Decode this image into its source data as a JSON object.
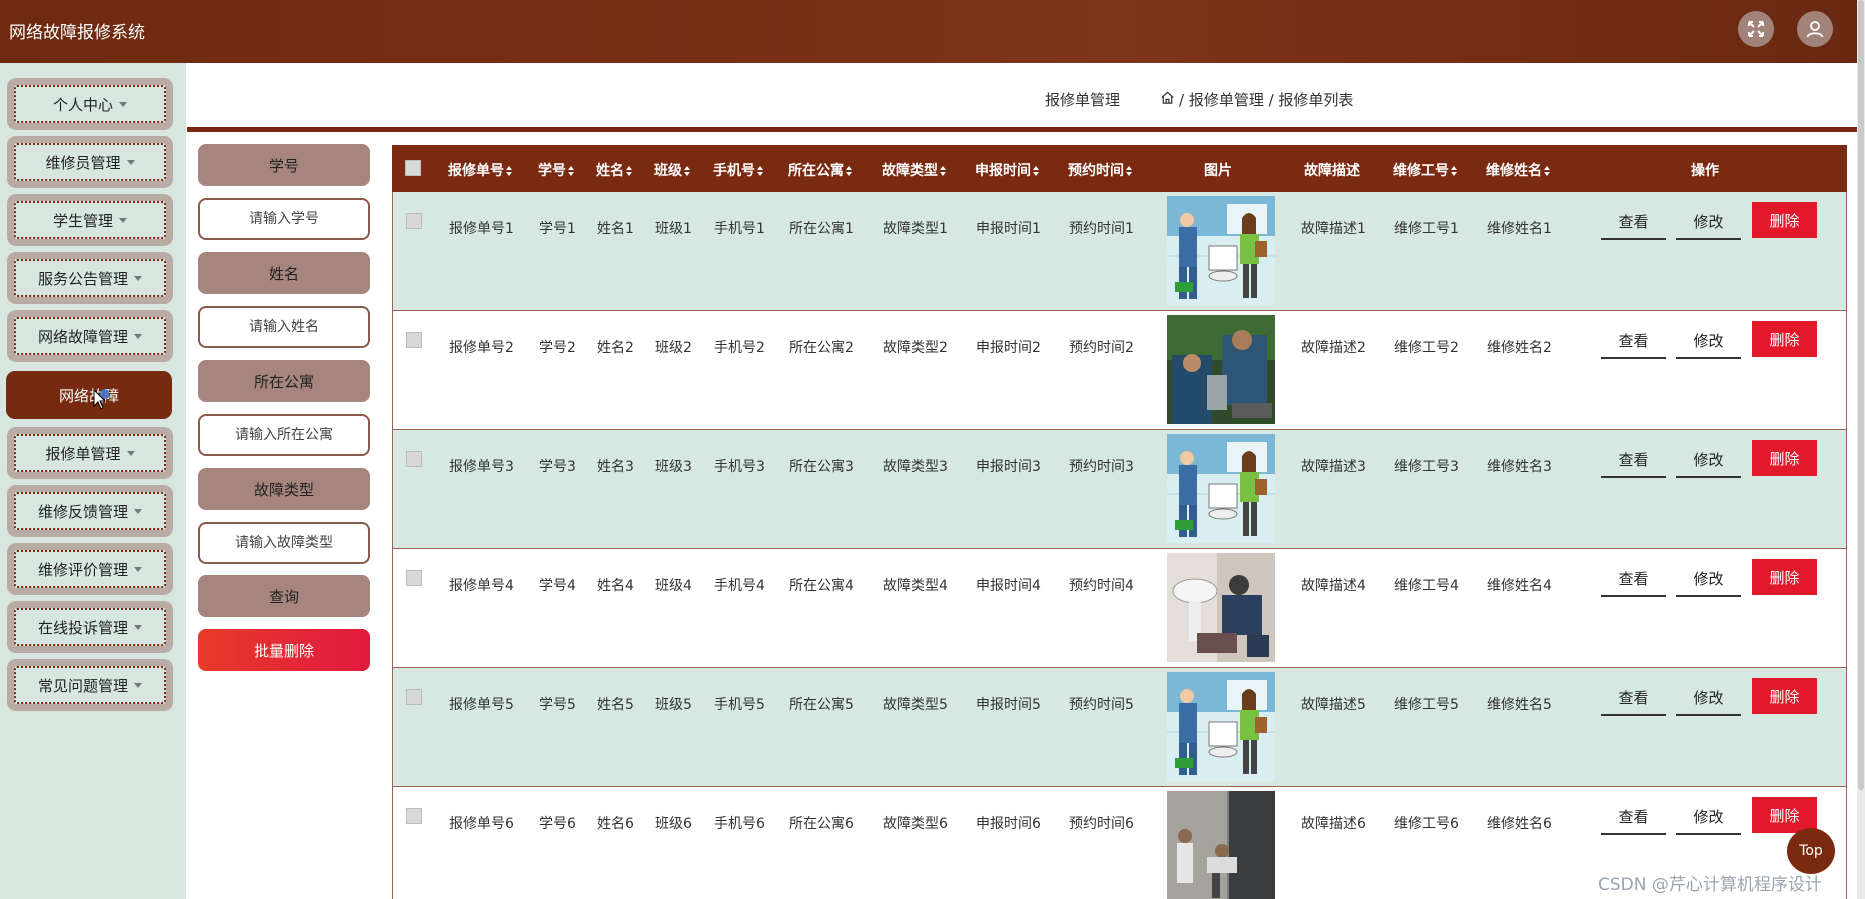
{
  "header": {
    "title": "网络故障报修系统",
    "brand_color": "#7b2a12"
  },
  "sidebar": {
    "items": [
      {
        "label": "个人中心"
      },
      {
        "label": "维修员管理"
      },
      {
        "label": "学生管理"
      },
      {
        "label": "服务公告管理"
      },
      {
        "label": "网络故障管理"
      },
      {
        "label": "网络故障",
        "active": true
      },
      {
        "label": "报修单管理"
      },
      {
        "label": "维修反馈管理"
      },
      {
        "label": "维修评价管理"
      },
      {
        "label": "在线投诉管理"
      },
      {
        "label": "常见问题管理"
      }
    ]
  },
  "breadcrumb": {
    "module": "报修单管理",
    "trail": "/ 报修单管理 / 报修单列表"
  },
  "search": {
    "label_id": "学号",
    "placeholder_id": "请输入学号",
    "label_name": "姓名",
    "placeholder_name": "请输入姓名",
    "label_apartment": "所在公寓",
    "placeholder_apartment": "请输入所在公寓",
    "label_fault": "故障类型",
    "placeholder_fault": "请输入故障类型",
    "query_label": "查询",
    "batch_delete_label": "批量删除"
  },
  "table": {
    "columns": [
      "报修单号",
      "学号",
      "姓名",
      "班级",
      "手机号",
      "所在公寓",
      "故障类型",
      "申报时间",
      "预约时间",
      "图片",
      "故障描述",
      "维修工号",
      "维修姓名",
      "操作"
    ],
    "rows": [
      {
        "no": "报修单号1",
        "sid": "学号1",
        "name": "姓名1",
        "cls": "班级1",
        "phone": "手机号1",
        "apt": "所在公寓1",
        "fault": "故障类型1",
        "report": "申报时间1",
        "appt": "预约时间1",
        "img": "cartoon-repair",
        "desc": "故障描述1",
        "wid": "维修工号1",
        "wname": "维修姓名1"
      },
      {
        "no": "报修单号2",
        "sid": "学号2",
        "name": "姓名2",
        "cls": "班级2",
        "phone": "手机号2",
        "apt": "所在公寓2",
        "fault": "故障类型2",
        "report": "申报时间2",
        "appt": "预约时间2",
        "img": "worker-photo",
        "desc": "故障描述2",
        "wid": "维修工号2",
        "wname": "维修姓名2"
      },
      {
        "no": "报修单号3",
        "sid": "学号3",
        "name": "姓名3",
        "cls": "班级3",
        "phone": "手机号3",
        "apt": "所在公寓3",
        "fault": "故障类型3",
        "report": "申报时间3",
        "appt": "预约时间3",
        "img": "cartoon-repair",
        "desc": "故障描述3",
        "wid": "维修工号3",
        "wname": "维修姓名3"
      },
      {
        "no": "报修单号4",
        "sid": "学号4",
        "name": "姓名4",
        "cls": "班级4",
        "phone": "手机号4",
        "apt": "所在公寓4",
        "fault": "故障类型4",
        "report": "申报时间4",
        "appt": "预约时间4",
        "img": "sink-photo",
        "desc": "故障描述4",
        "wid": "维修工号4",
        "wname": "维修姓名4"
      },
      {
        "no": "报修单号5",
        "sid": "学号5",
        "name": "姓名5",
        "cls": "班级5",
        "phone": "手机号5",
        "apt": "所在公寓5",
        "fault": "故障类型5",
        "report": "申报时间5",
        "appt": "预约时间5",
        "img": "cartoon-repair",
        "desc": "故障描述5",
        "wid": "维修工号5",
        "wname": "维修姓名5"
      },
      {
        "no": "报修单号6",
        "sid": "学号6",
        "name": "姓名6",
        "cls": "班级6",
        "phone": "手机号6",
        "apt": "所在公寓6",
        "fault": "故障类型6",
        "report": "申报时间6",
        "appt": "预约时间6",
        "img": "door-photo",
        "desc": "故障描述6",
        "wid": "维修工号6",
        "wname": "维修姓名6"
      }
    ],
    "actions": {
      "view": "查看",
      "edit": "修改",
      "delete": "删除"
    }
  },
  "top_button": "Top",
  "watermark": "CSDN @芹心计算机程序设计"
}
